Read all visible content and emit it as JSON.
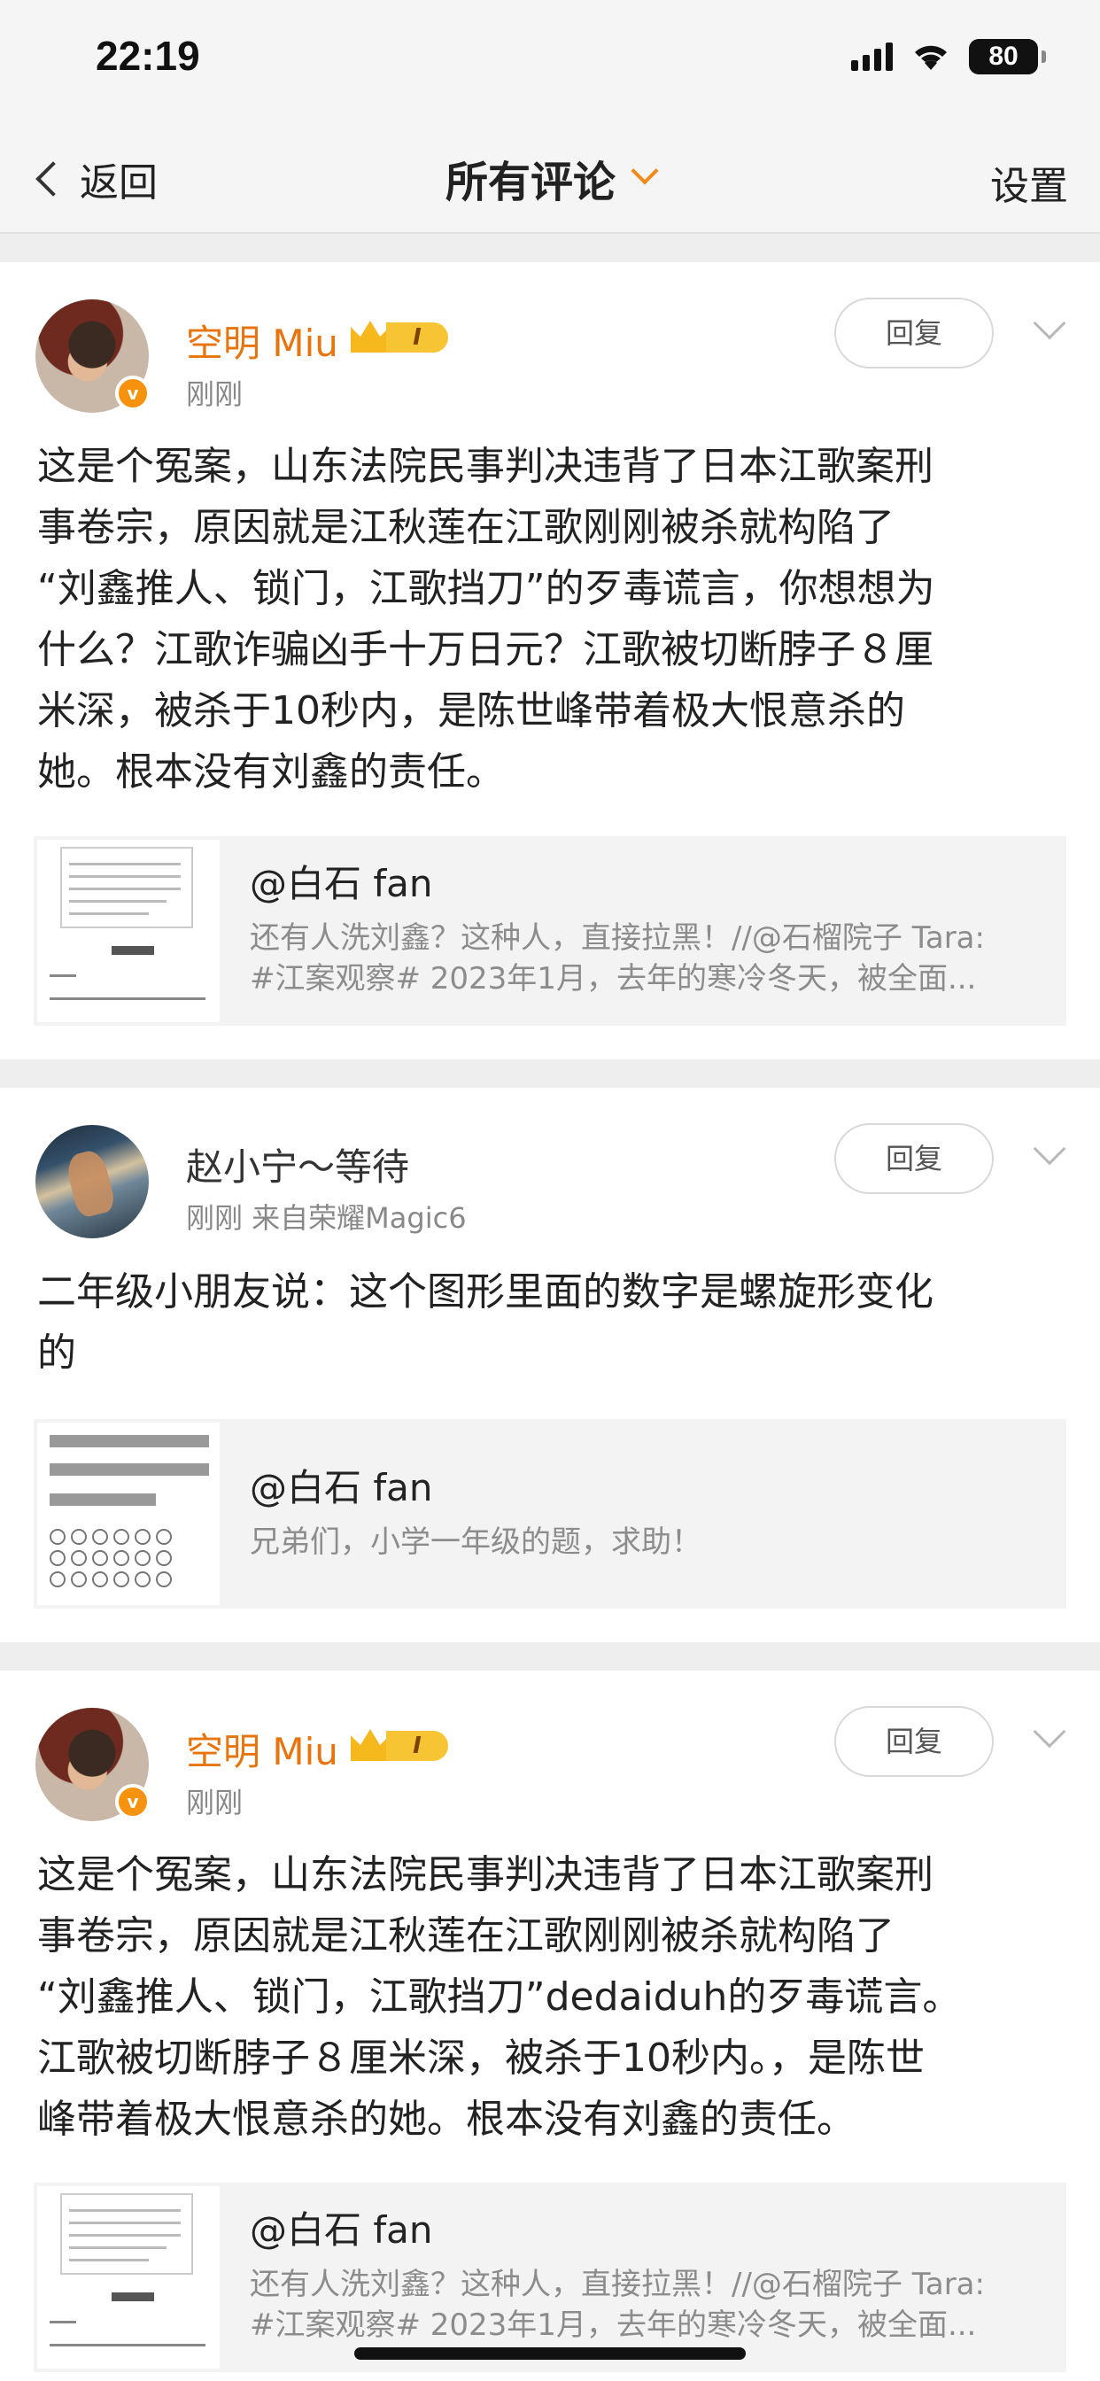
{
  "status_bar": {
    "time": "22:19",
    "battery": "80"
  },
  "nav": {
    "back_label": "返回",
    "title": "所有评论",
    "settings_label": "设置"
  },
  "comments": [
    {
      "name": "空明 Miu",
      "level_badge": "I",
      "verified_badge": "v",
      "meta": "刚刚",
      "reply_label": "回复",
      "lines": [
        "这是个冤案，山东法院民事判决违背了日本江歌案刑",
        "事卷宗，原因就是江秋莲在江歌刚刚被杀就构陷了",
        "“刘鑫推人、锁门，江歌挡刀”的歹毒谎言，你想想为",
        "什么？江歌诈骗凶手十万日元？江歌被切断脖子８厘",
        "米深，被杀于10秒内，是陈世峰带着极大恨意杀的",
        "她。根本没有刘鑫的责任。"
      ],
      "quote": {
        "user": "@白石 fan",
        "line1": "还有人洗刘鑫？这种人，直接拉黑！//@石榴院子 Tara:",
        "line2": "#江案观察# 2023年1月，去年的寒冷冬天，被全面..."
      }
    },
    {
      "name": "赵小宁～等待",
      "meta": "刚刚   来自荣耀Magic6",
      "reply_label": "回复",
      "lines": [
        "二年级小朋友说：这个图形里面的数字是螺旋形变化",
        "的"
      ],
      "quote": {
        "user": "@白石 fan",
        "line1": "兄弟们，小学一年级的题，求助！"
      }
    },
    {
      "name": "空明 Miu",
      "level_badge": "I",
      "verified_badge": "v",
      "meta": "刚刚",
      "reply_label": "回复",
      "lines": [
        "这是个冤案，山东法院民事判决违背了日本江歌案刑",
        "事卷宗，原因就是江秋莲在江歌刚刚被杀就构陷了",
        "“刘鑫推人、锁门，江歌挡刀”dedaiduh的歹毒谎言。",
        "江歌被切断脖子８厘米深，被杀于10秒内。，是陈世",
        "峰带着极大恨意杀的她。根本没有刘鑫的责任。"
      ],
      "quote": {
        "user": "@白石 fan",
        "line1": "还有人洗刘鑫？这种人，直接拉黑！//@石榴院子 Tara:",
        "line2": "#江案观察# 2023年1月，去年的寒冷冬天，被全面..."
      }
    }
  ]
}
